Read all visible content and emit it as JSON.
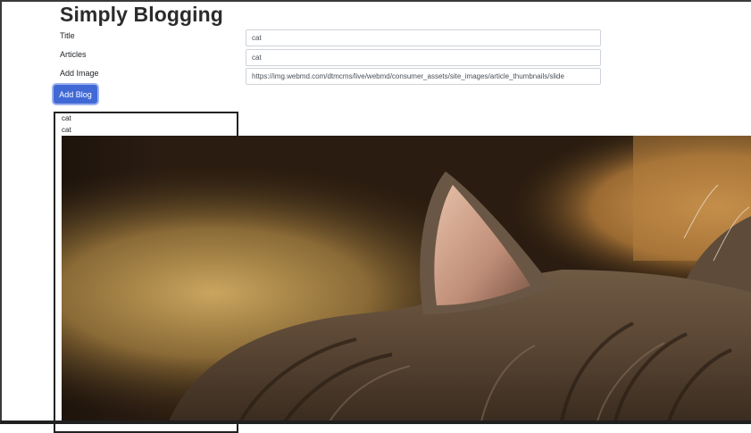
{
  "app": {
    "title": "Simply Blogging"
  },
  "form": {
    "title_label": "Title",
    "title_value": "cat",
    "articles_label": "Articles",
    "articles_value": "cat",
    "image_label": "Add Image",
    "image_value": "https://img.webmd.com/dtmcms/live/webmd/consumer_assets/site_images/article_thumbnails/slide",
    "submit_label": "Add Blog"
  },
  "blogs": [
    {
      "title": "cat",
      "article": "cat",
      "image_subject": "cat-photo"
    }
  ],
  "colors": {
    "button": "#4169d6",
    "button_focus_ring": "#9fb3ee",
    "card_border": "#222222",
    "input_border": "#ced4da"
  }
}
